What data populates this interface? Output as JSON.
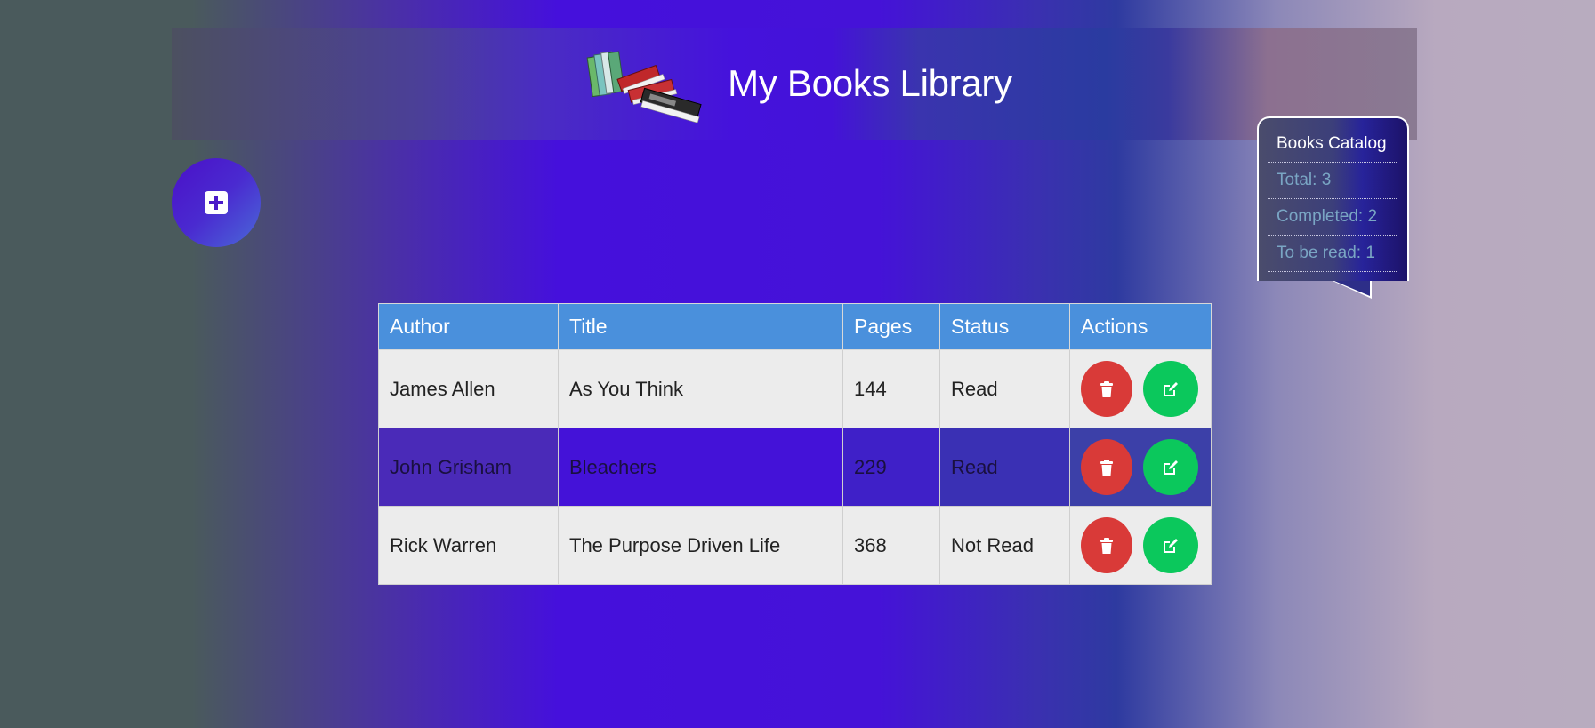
{
  "header": {
    "title": "My Books Library",
    "logo_icon": "books-stack-icon"
  },
  "add_button": {
    "icon": "plus-square-icon"
  },
  "catalog": {
    "title": "Books Catalog",
    "total": "Total: 3",
    "completed": "Completed: 2",
    "to_be_read": "To be read: 1"
  },
  "table": {
    "columns": [
      "Author",
      "Title",
      "Pages",
      "Status",
      "Actions"
    ],
    "rows": [
      {
        "author": "James Allen",
        "title": "As You Think",
        "pages": "144",
        "status": "Read"
      },
      {
        "author": "John Grisham",
        "title": "Bleachers",
        "pages": "229",
        "status": "Read"
      },
      {
        "author": "Rick Warren",
        "title": "The Purpose Driven Life",
        "pages": "368",
        "status": "Not Read"
      }
    ],
    "action_icons": [
      "trash-icon",
      "edit-icon"
    ]
  },
  "colors": {
    "header_bg": "#4a90dc",
    "delete": "#d93a38",
    "edit": "#0bc85c",
    "accent": "#4512dc"
  }
}
